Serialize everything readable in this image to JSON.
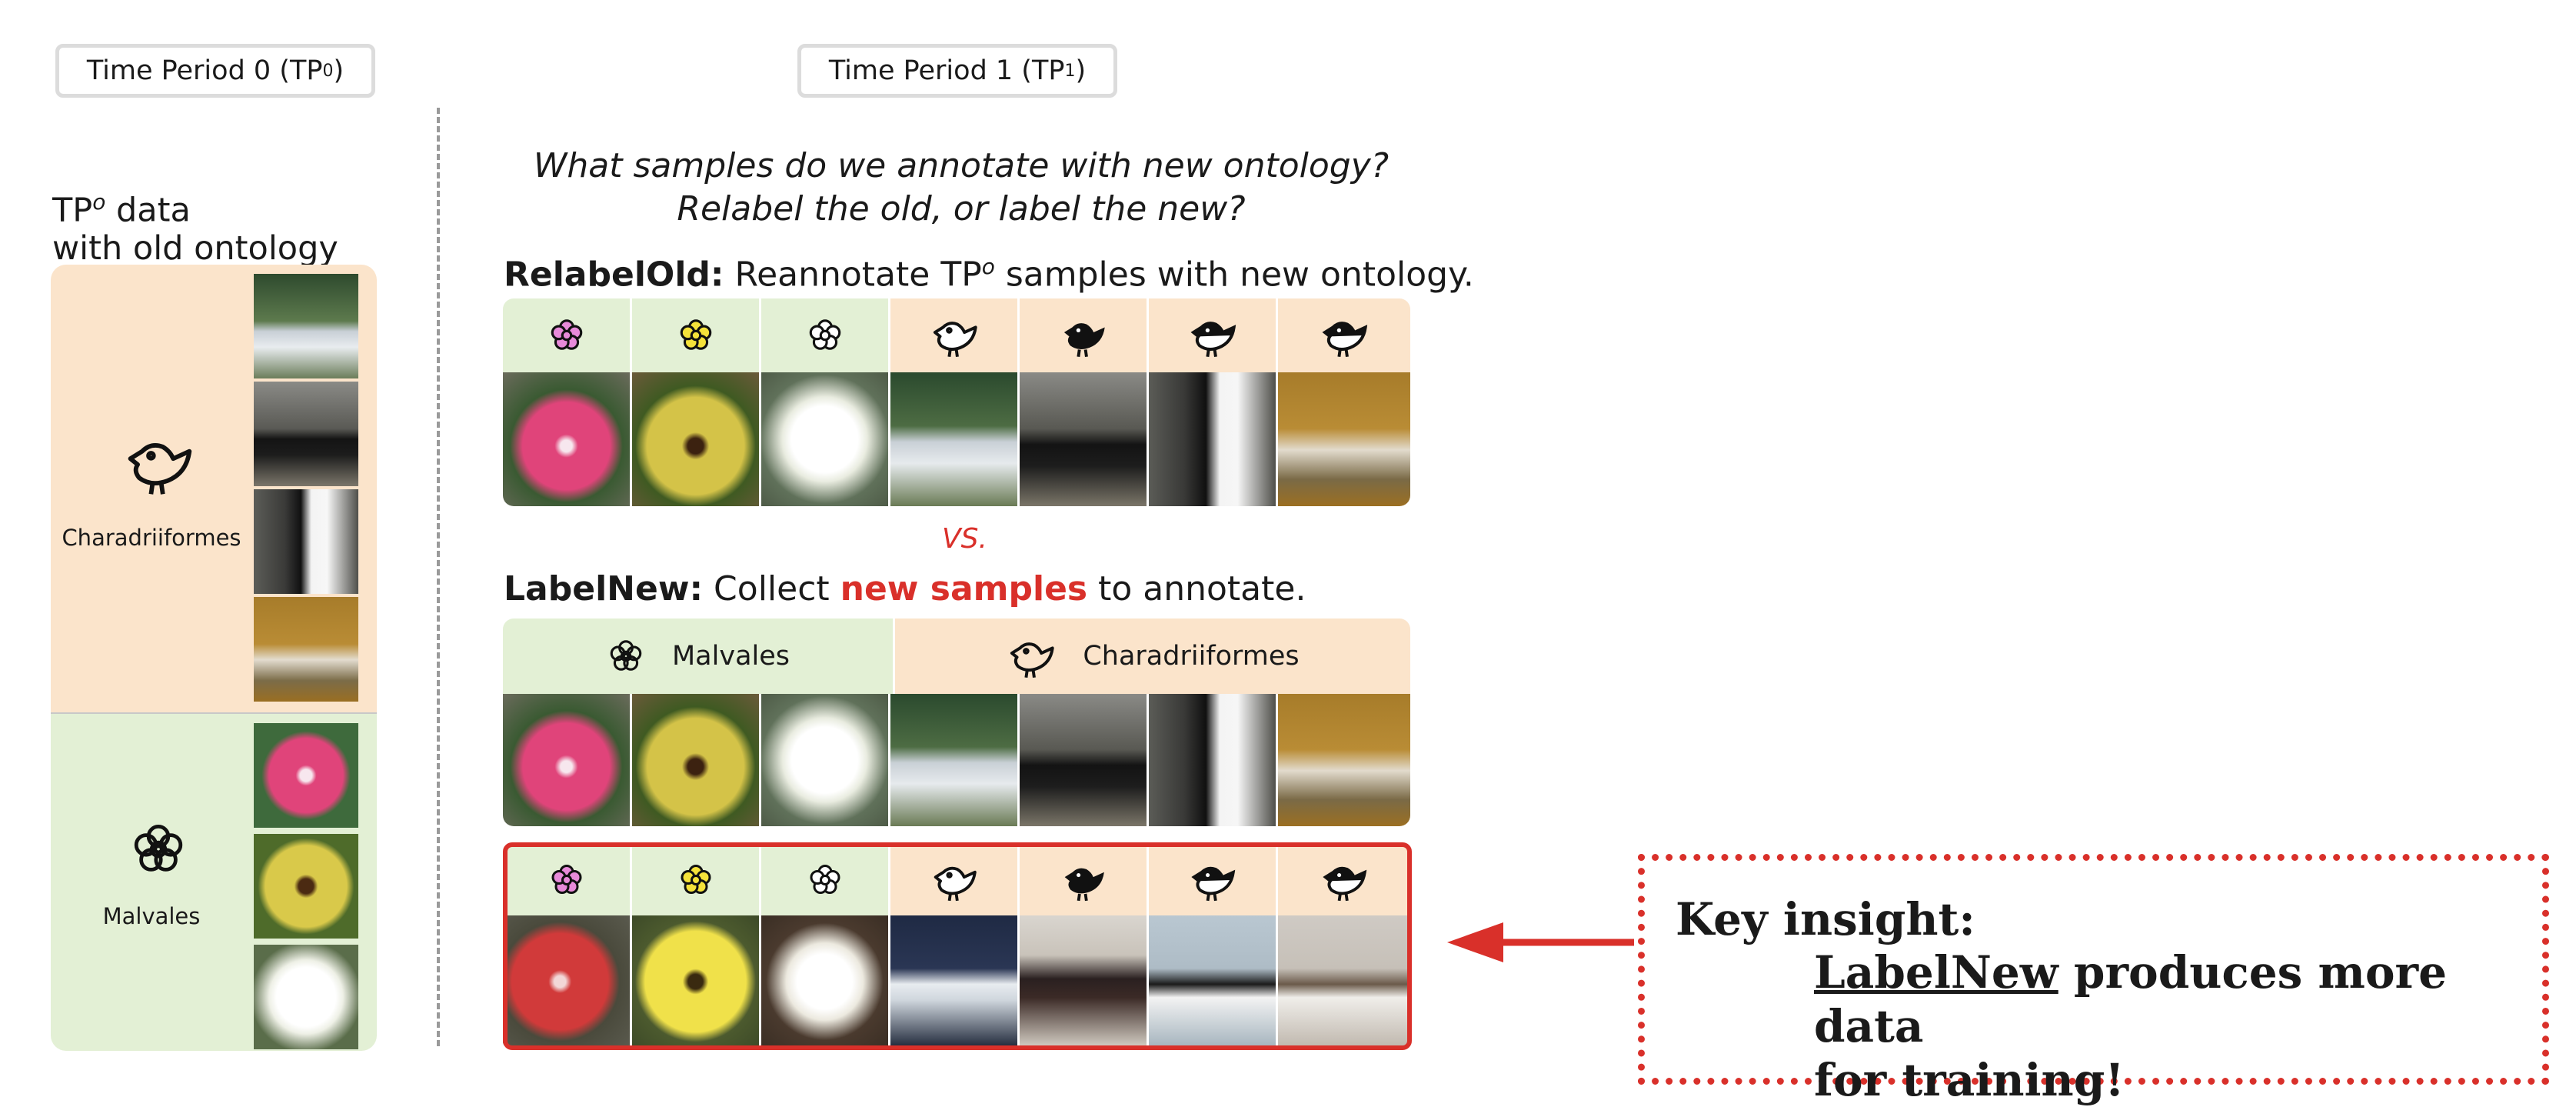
{
  "header": {
    "tp0_label": "Time Period 0 (TP",
    "tp0_sup": "0",
    "tp1_label": "Time Period 1 (TP",
    "tp1_sup": "1",
    "close_paren": ")"
  },
  "left": {
    "title_line1_a": "TP",
    "title_line1_sup": "o",
    "title_line1_b": " data",
    "title_line2": "with old ontology",
    "orange_group_label": "Charadriiformes",
    "green_group_label": "Malvales"
  },
  "question": {
    "line1": "What samples do we annotate with new ontology?",
    "line2": "Relabel the old, or label the new?"
  },
  "relabel": {
    "bold": "RelabelOld:",
    "text_a": " Reannotate TP",
    "sup": "o",
    "text_b": " samples with new ontology."
  },
  "vs": "VS.",
  "labelnew": {
    "bold": "LabelNew:",
    "text_a": " Collect ",
    "highlight": "new samples",
    "text_b": " to annotate."
  },
  "groups": {
    "malvales": "Malvales",
    "charadriiformes": "Charadriiformes"
  },
  "insight": {
    "title": "Key insight:",
    "labelnew": "LabelNew",
    "rest_line1": " produces more data",
    "line2": "for training!"
  },
  "colors": {
    "accent_red": "#d9302a",
    "orange_bg": "#fbe4cb",
    "green_bg": "#e3f0d5"
  }
}
